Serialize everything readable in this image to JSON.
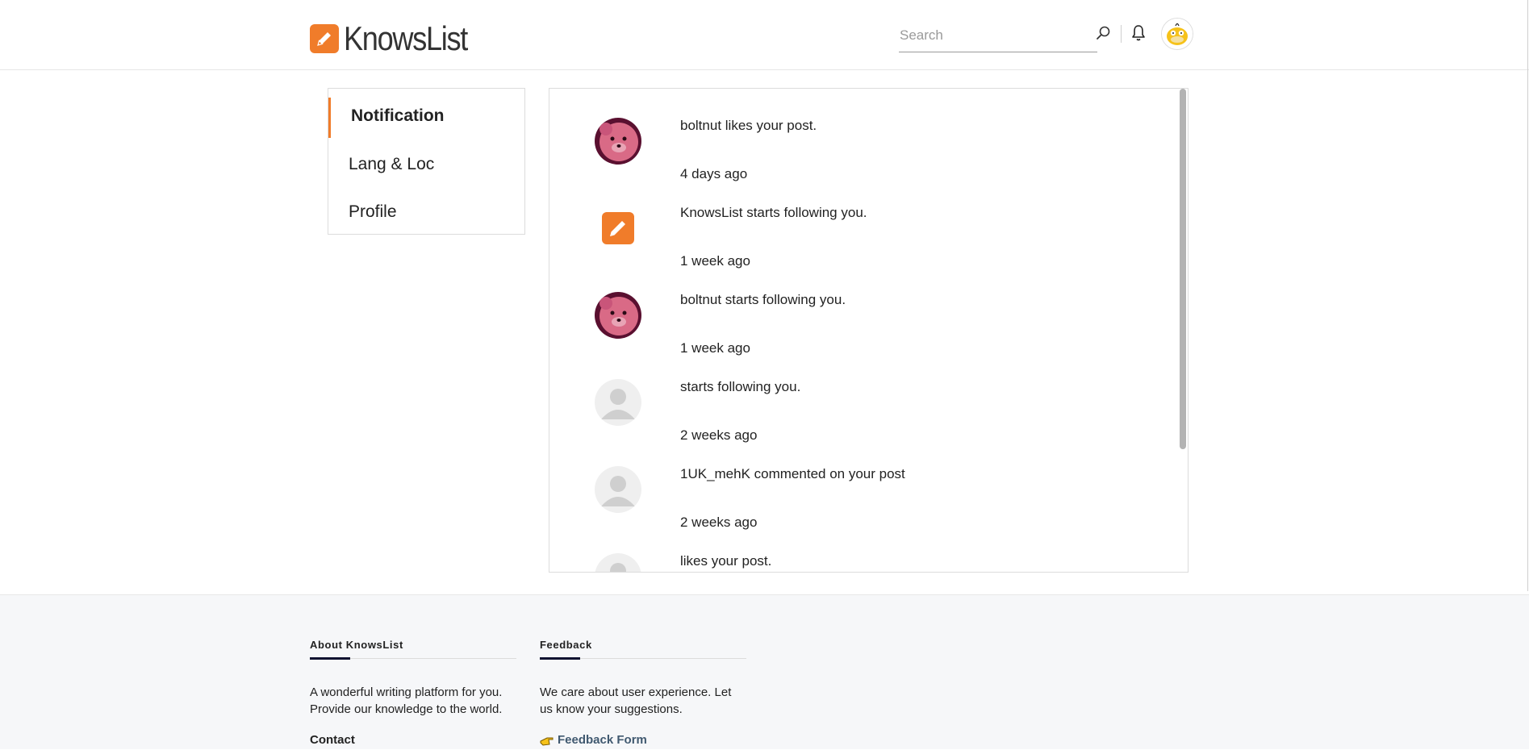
{
  "header": {
    "brand": "KnowsList",
    "search_placeholder": "Search"
  },
  "sidebar": {
    "items": [
      {
        "label": "Notification",
        "active": true
      },
      {
        "label": "Lang & Loc",
        "active": false
      },
      {
        "label": "Profile",
        "active": false
      }
    ]
  },
  "notifications": [
    {
      "avatar": "teddy-bear-avatar",
      "text": "boltnut likes your post.",
      "time": "4 days ago"
    },
    {
      "avatar": "knowslist-logo-avatar",
      "text": "KnowsList starts following you.",
      "time": "1 week ago"
    },
    {
      "avatar": "teddy-bear-avatar",
      "text": "boltnut starts following you.",
      "time": "1 week ago"
    },
    {
      "avatar": "default-user-avatar",
      "text": "starts following you.",
      "time": "2 weeks ago"
    },
    {
      "avatar": "default-user-avatar",
      "text": "1UK_mehK commented on your post",
      "time": "2 weeks ago"
    },
    {
      "avatar": "default-user-avatar",
      "text": "likes your post.",
      "time": ""
    }
  ],
  "footer": {
    "about": {
      "heading": "About KnowsList",
      "body": "A wonderful writing platform for you. Provide our knowledge to the world.",
      "contact": "Contact"
    },
    "feedback": {
      "heading": "Feedback",
      "body": "We care about user experience. Let us know your suggestions.",
      "link": "Feedback Form"
    }
  },
  "colors": {
    "accent": "#f07c2a",
    "footer_bg": "#f6f7f9",
    "link": "#405970"
  }
}
